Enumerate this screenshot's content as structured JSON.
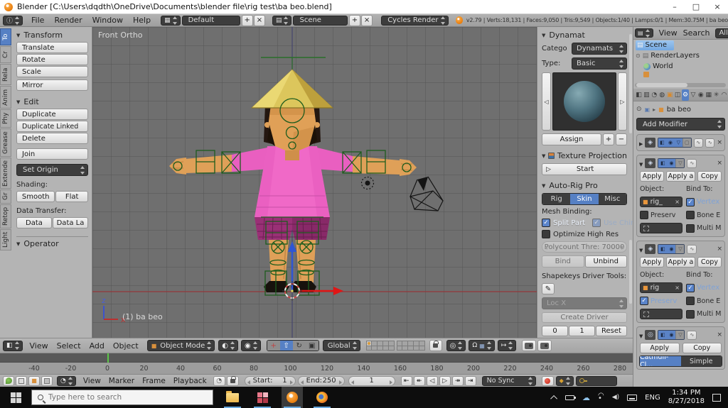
{
  "titlebar": {
    "title": "Blender [C:\\Users\\dqdth\\OneDrive\\Documents\\blender file\\rig test\\ba beo.blend]",
    "minimize": "–",
    "maximize": "□",
    "close": "×"
  },
  "info_header": {
    "menus": [
      "File",
      "Render",
      "Window",
      "Help"
    ],
    "layout_name": "Default",
    "scene_name": "Scene",
    "engine": "Cycles Render",
    "stats": "v2.79 | Verts:18,131 | Faces:9,050 | Tris:9,549 | Objects:1/40 | Lamps:0/1 | Mem:30.75M | ba beo"
  },
  "tool_shelf": {
    "tabs": [
      "To",
      "Cr",
      "Rela",
      "Anim",
      "Phy",
      "Grease",
      "Extende",
      "Gr",
      "Retop",
      "Light"
    ],
    "transform": {
      "title": "Transform",
      "translate": "Translate",
      "rotate": "Rotate",
      "scale": "Scale",
      "mirror": "Mirror"
    },
    "edit": {
      "title": "Edit",
      "duplicate": "Duplicate",
      "duplicate_linked": "Duplicate Linked",
      "delete": "Delete",
      "join": "Join",
      "set_origin": "Set Origin",
      "shading_label": "Shading:",
      "smooth": "Smooth",
      "flat": "Flat",
      "data_transfer_label": "Data Transfer:",
      "data": "Data",
      "data_la": "Data La"
    },
    "operator": "Operator"
  },
  "viewport": {
    "view_label": "Front Ortho",
    "object_label": "(1) ba beo",
    "axis_z": "z",
    "axis_x": "x"
  },
  "n_shelf": {
    "dynamat": {
      "title": "Dynamat",
      "category_label": "Catego",
      "category_value": "Dynamats",
      "type_label": "Type:",
      "type_value": "Basic",
      "assign": "Assign"
    },
    "texture_projection": {
      "title": "Texture Projection",
      "start": "Start"
    },
    "auto_rig": {
      "title": "Auto-Rig Pro",
      "tab_rig": "Rig",
      "tab_skin": "Skin",
      "tab_misc": "Misc",
      "mesh_binding_label": "Mesh Binding:",
      "split_part": "Split Part",
      "use_chin": "Use Chin",
      "optimize": "Optimize High Res",
      "polycount": "Polycount Thre: 70000",
      "bind": "Bind",
      "unbind": "Unbind",
      "shapekeys_label": "Shapekeys Driver Tools:",
      "driver_channel": "Loc X",
      "create_driver": "Create Driver",
      "val_zero": "0",
      "val_one": "1",
      "reset": "Reset"
    }
  },
  "outliner": {
    "view": "View",
    "search": "Search",
    "scope": "All Sc",
    "items": [
      "Scene",
      "RenderLayers",
      "World"
    ]
  },
  "properties": {
    "breadcrumb_object": "ba beo",
    "add_modifier": "Add Modifier",
    "mod_a": {
      "apply": "Apply",
      "apply_as": "Apply a",
      "copy": "Copy",
      "object_label": "Object:",
      "bind_label": "Bind To:",
      "object_value": "rig_",
      "vertex": "Vertex",
      "preserve": "Preserv",
      "bone": "Bone E",
      "multi": "Multi M"
    },
    "mod_b": {
      "apply": "Apply",
      "apply_as": "Apply a",
      "copy": "Copy",
      "object_label": "Object:",
      "bind_label": "Bind To:",
      "object_value": "rig",
      "vertex": "Vertex",
      "preserve": "Preserv",
      "bone": "Bone E",
      "multi": "Multi M"
    },
    "mod_c": {
      "apply": "Apply",
      "copy": "Copy",
      "subdiv_type_a": "Catmull-Cl...",
      "subdiv_type_b": "Simple"
    }
  },
  "view3d_header": {
    "menus": [
      "View",
      "Select",
      "Add",
      "Object"
    ],
    "mode": "Object Mode",
    "orientation": "Global"
  },
  "timeline": {
    "ruler": [
      "-40",
      "-20",
      "0",
      "20",
      "40",
      "60",
      "80",
      "100",
      "120",
      "140",
      "160",
      "180",
      "200",
      "220",
      "240",
      "260",
      "280"
    ],
    "menus": [
      "View",
      "Marker",
      "Frame",
      "Playback"
    ],
    "start_label": "Start:",
    "start_value": "1",
    "end_label": "End:",
    "end_value": "250",
    "current_frame": "1",
    "sync": "No Sync"
  },
  "taskbar": {
    "search_placeholder": "Type here to search",
    "language": "ENG",
    "time": "1:34 PM",
    "date": "8/27/2018"
  },
  "icons": {
    "props_tabs": [
      "◧",
      "▥",
      "◔",
      "◍",
      "▣",
      "◫",
      "⚙",
      "▽",
      "◉",
      "▦",
      "✳",
      "◠"
    ],
    "arrow_left": "◁",
    "arrow_right": "▷",
    "plus": "+",
    "minus": "−",
    "play": "▷",
    "close": "×",
    "toggles": [
      "◧",
      "◉",
      "▽",
      "▢"
    ],
    "mod_deform": "◈",
    "mod_subsurf": "◎",
    "eyedropper": "✎",
    "pin": "⊙",
    "crumb_arrow": "▸",
    "expander": "⊙",
    "editor_info": "ⓘ",
    "editor_view3d": "◧",
    "editor_timeline": "◔",
    "editor_outliner": "▤",
    "grid": "▦",
    "image": "▤",
    "cube": "■",
    "shading_sphere": "◐",
    "pivot": "◉",
    "manip_axes": "+",
    "manip_translate": "⇧",
    "manip_rotate": "↻",
    "manip_scale": "▣",
    "prop_edit": "◎",
    "magnet": "Ω",
    "snap_target": "↦",
    "jump_start": "⇤",
    "prev_key": "↞",
    "play_rev": "◁",
    "play_fwd": "▷",
    "next_key": "↠",
    "jump_end": "⇥",
    "keying_dot": "◆",
    "clock": "◔"
  }
}
